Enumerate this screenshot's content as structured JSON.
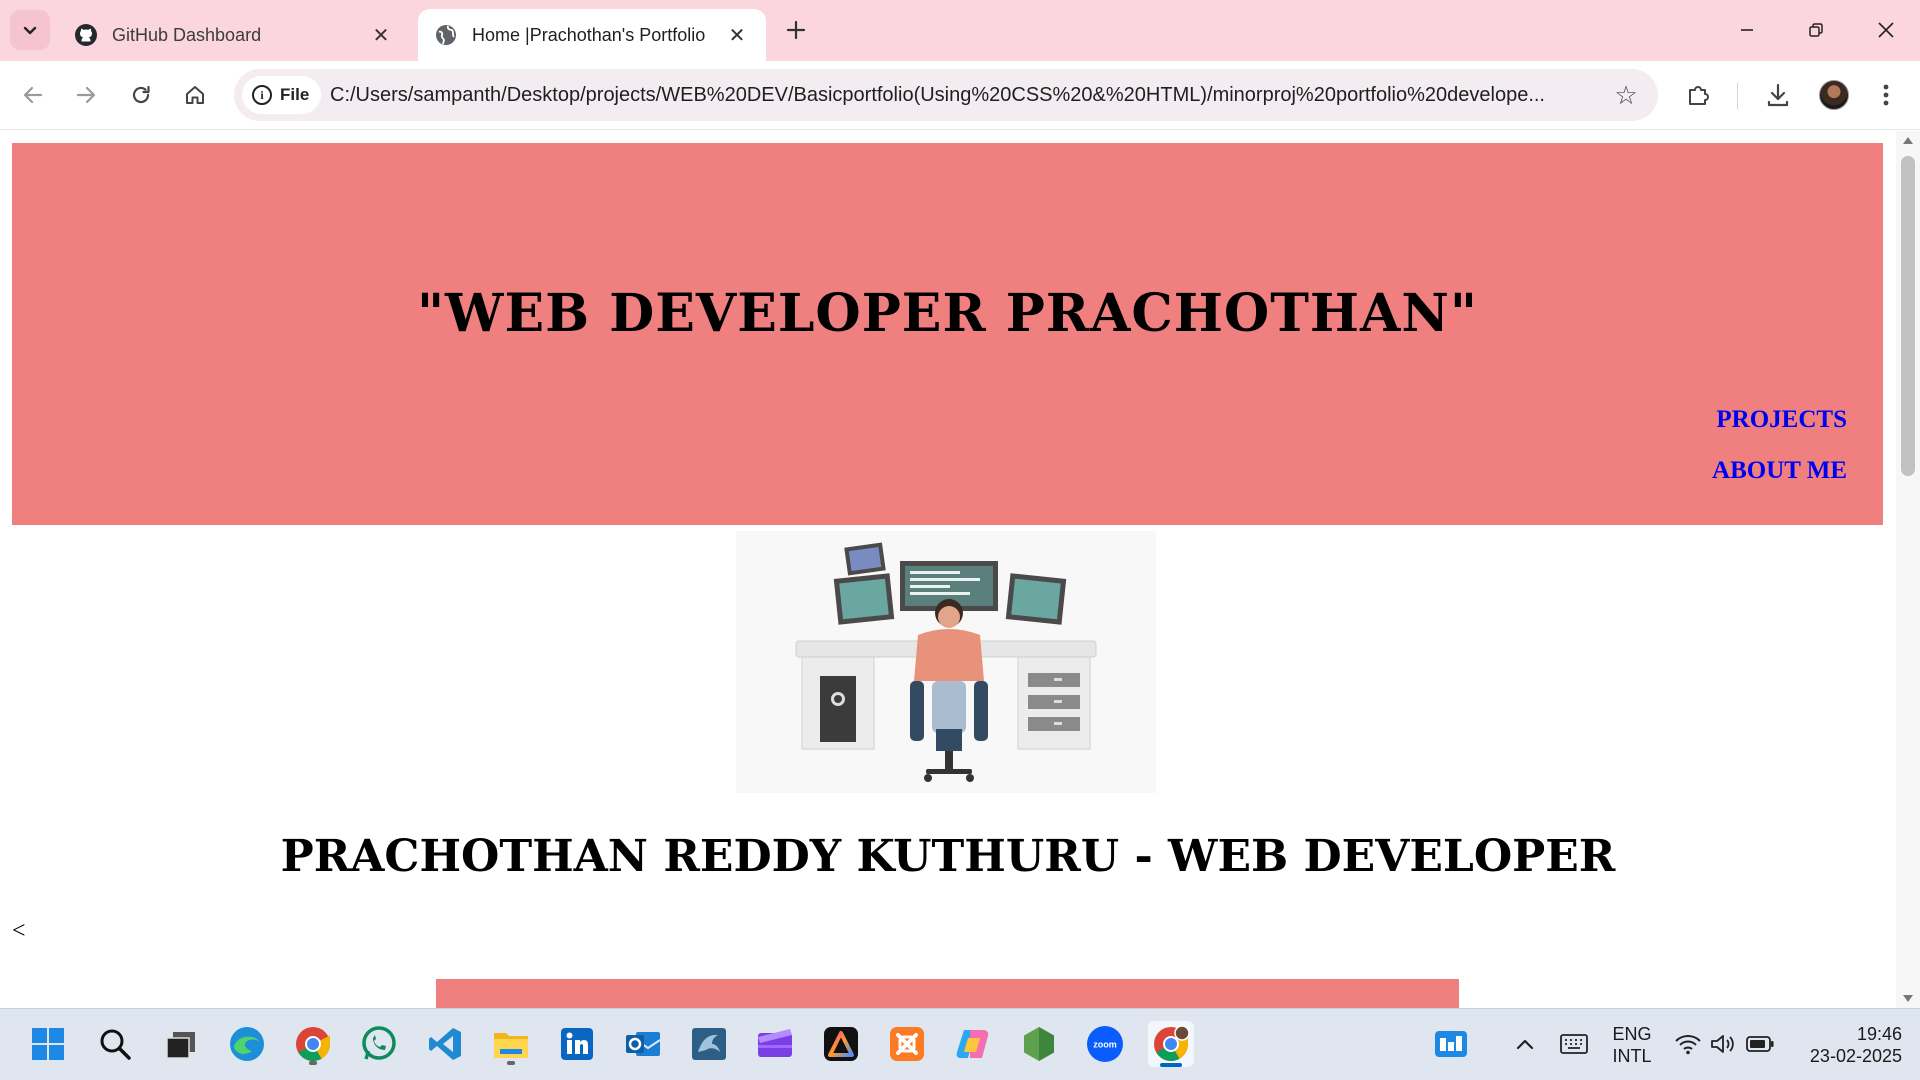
{
  "browser": {
    "tabs": [
      {
        "title": "GitHub Dashboard",
        "icon": "github-icon",
        "active": false
      },
      {
        "title": "Home |Prachothan's Portfolio",
        "icon": "globe-icon",
        "active": true
      }
    ],
    "site_chip_label": "File",
    "url": "C:/Users/sampanth/Desktop/projects/WEB%20DEV/Basicportfolio(Using%20CSS%20&%20HTML)/minorproj%20portfolio%20develope..."
  },
  "page": {
    "hero_title": "\"WEB DEVELOPER PRACHOTHAN\"",
    "nav": {
      "projects": "PROJECTS",
      "about": "ABOUT ME"
    },
    "heading": "PRACHOTHAN REDDY KUTHURU - WEB DEVELOPER",
    "stray_text": "<",
    "colors": {
      "hero_bg": "#f08080",
      "nav_link": "#0000ee"
    }
  },
  "taskbar": {
    "apps": [
      "windows-start-icon",
      "search-icon",
      "task-view-icon",
      "edge-icon",
      "chrome-icon",
      "whatsapp-icon",
      "vscode-icon",
      "file-explorer-icon",
      "linkedin-icon",
      "outlook-icon",
      "mysql-workbench-icon",
      "clipchamp-icon",
      "adobe-express-icon",
      "xampp-icon",
      "copilot-icon",
      "nodejs-icon",
      "zoom-icon",
      "chrome-profile-icon"
    ],
    "zoom_label": "zoom",
    "lang_line1": "ENG",
    "lang_line2": "INTL",
    "time": "19:46",
    "date": "23-02-2025"
  }
}
